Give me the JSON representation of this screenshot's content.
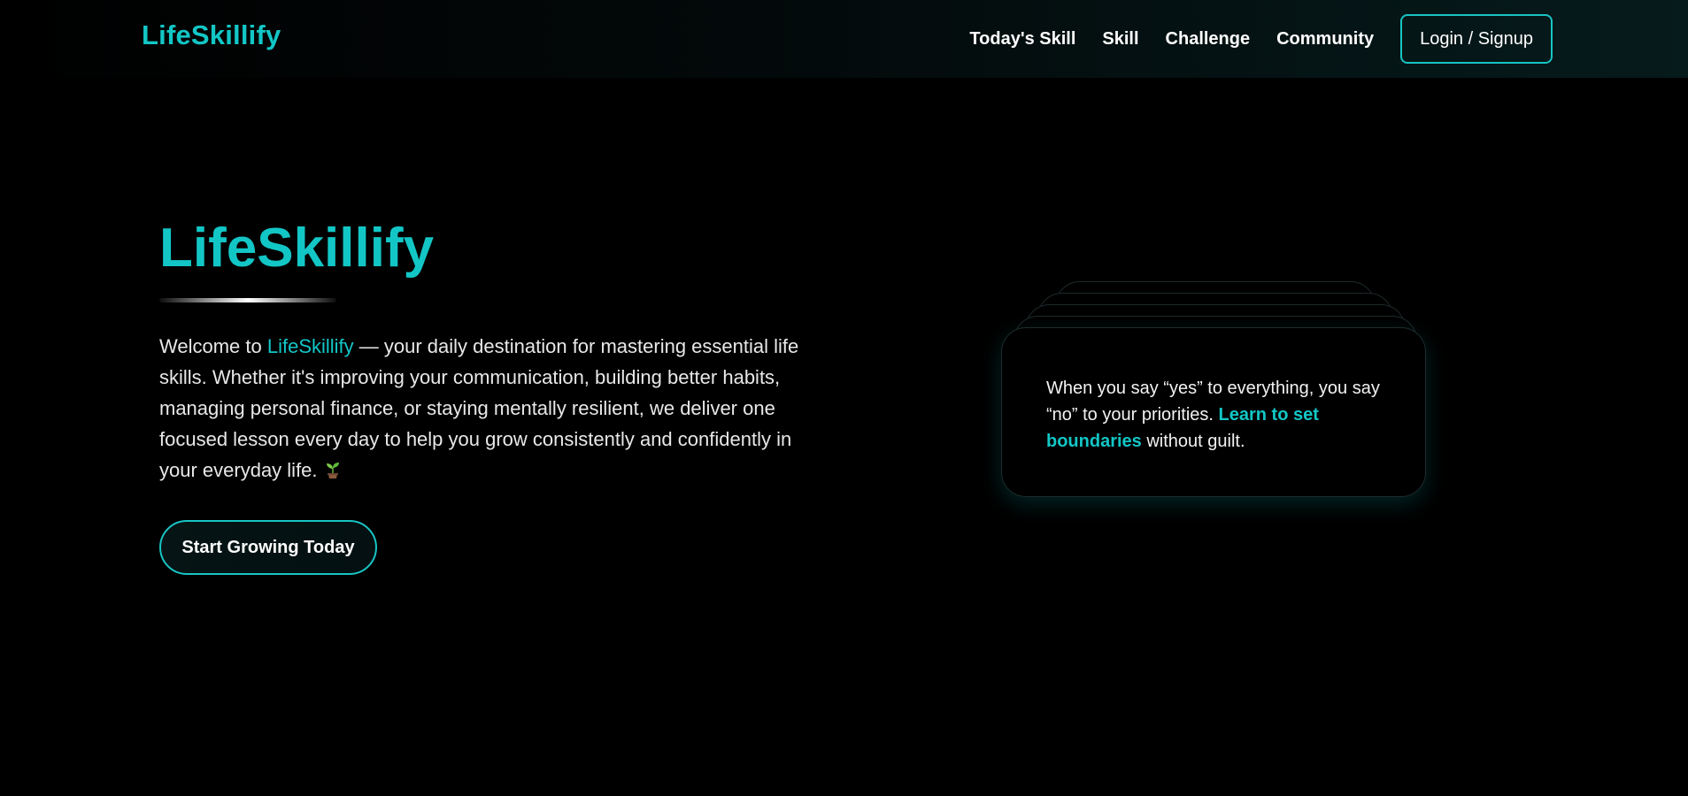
{
  "nav": {
    "brand": "LifeSkillify",
    "links": [
      "Today's Skill",
      "Skill",
      "Challenge",
      "Community"
    ],
    "login_label": "Login / Signup"
  },
  "hero": {
    "title": "LifeSkillify",
    "intro_before": "Welcome to ",
    "intro_brand": "LifeSkillify",
    "intro_after": " — your daily destination for mastering essential life skills. Whether it's improving your communication, building better habits, managing personal finance, or staying mentally resilient, we deliver one focused lesson every day to help you grow consistently and confidently in your everyday life.",
    "intro_icon": "sprout-icon",
    "cta_label": "Start Growing Today"
  },
  "quote_card": {
    "text_before": "When you say “yes” to everything, you say “no” to your priorities. ",
    "link_text": "Learn to set boundaries",
    "text_after": " without guilt."
  },
  "colors": {
    "accent": "#13c6c6",
    "background": "#000000",
    "text": "#ffffff"
  }
}
